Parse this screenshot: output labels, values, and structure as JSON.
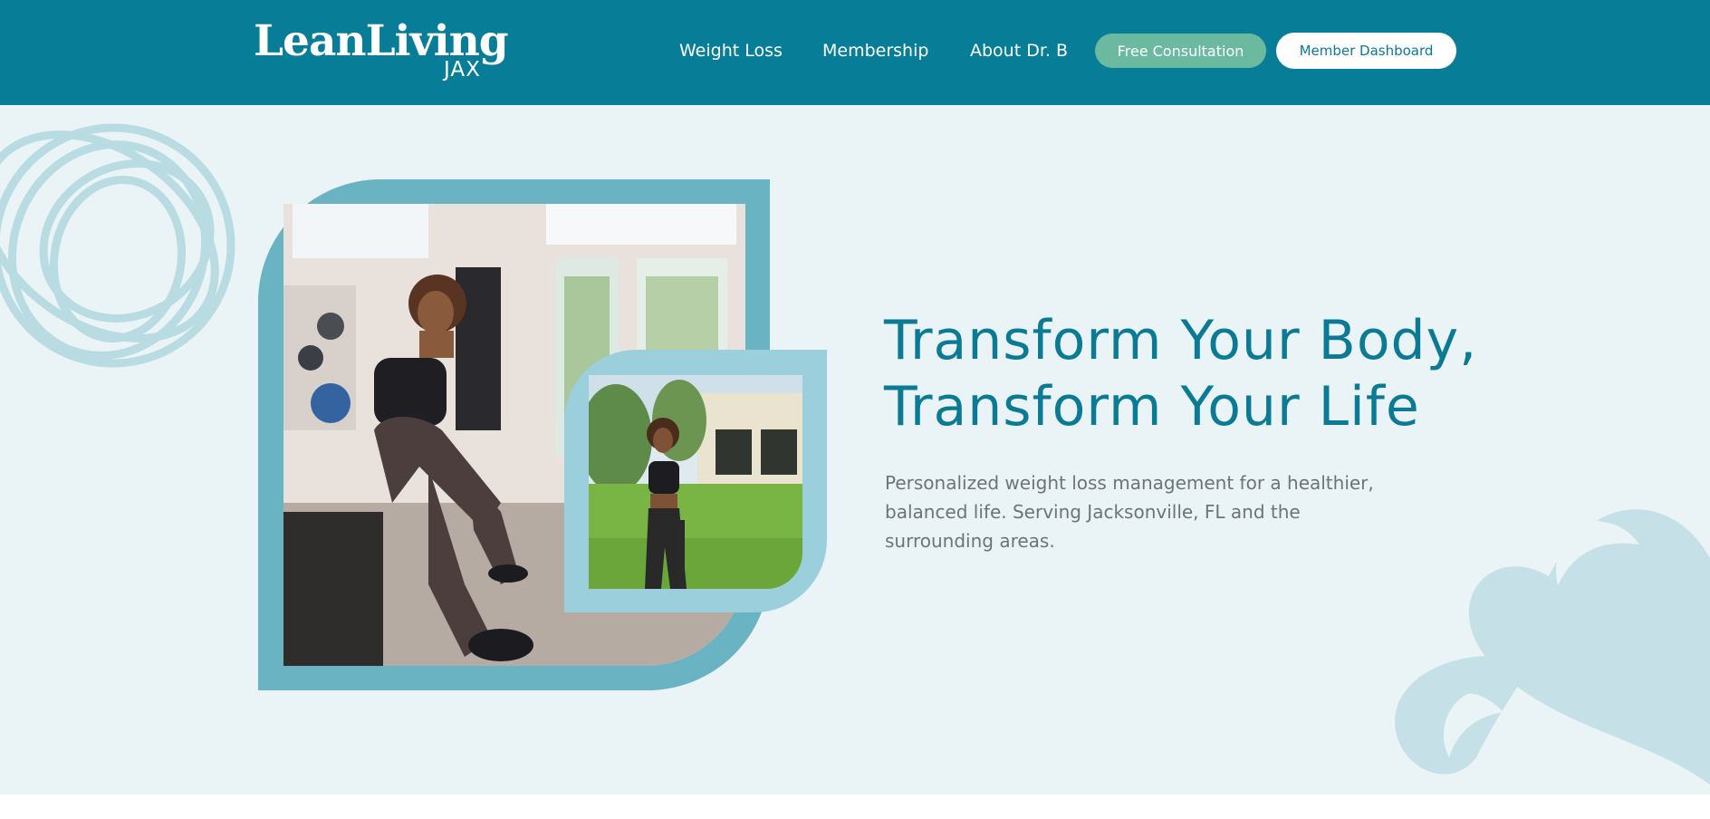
{
  "header": {
    "logo": {
      "main": "LeanLiving",
      "sub": "JAX"
    },
    "nav": [
      {
        "label": "Weight Loss"
      },
      {
        "label": "Membership"
      },
      {
        "label": "About Dr. B"
      }
    ],
    "cta_consult": "Free Consultation",
    "cta_dashboard": "Member Dashboard"
  },
  "hero": {
    "headline_line1": "Transform Your Body,",
    "headline_line2": "Transform Your Life",
    "subtext": "Personalized weight loss management for a healthier, balanced life. Serving Jacksonville, FL and the surrounding areas.",
    "images": [
      {
        "icon": "photo-woman-seated-gym"
      },
      {
        "icon": "photo-woman-outdoors"
      }
    ]
  },
  "colors": {
    "header_bg": "#077d98",
    "hero_bg": "#eaf3f6",
    "accent_green": "#6bb99e",
    "headline": "#0b7b95",
    "frame_dark": "#6ab3c2",
    "frame_light": "#9ccfdc"
  }
}
